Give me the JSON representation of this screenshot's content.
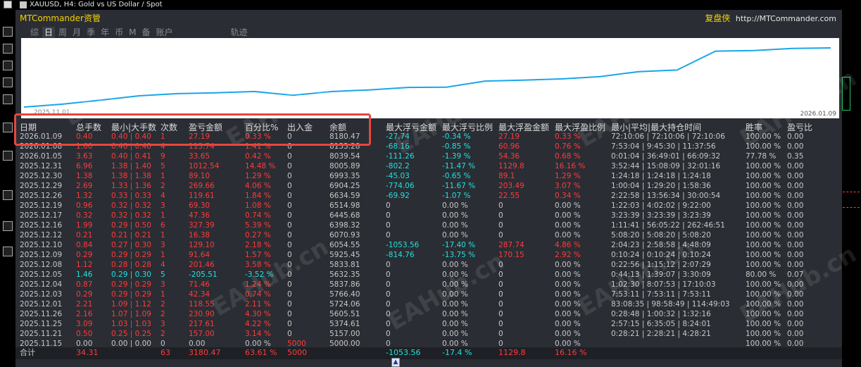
{
  "window": {
    "symbol_line": "XAUUSD, H4:  Gold vs US Dollar / Spot"
  },
  "panel": {
    "brand": "MTCommander资管",
    "right_brand_cn": "复盘侠",
    "right_brand_url": "http://MTCommander.com",
    "tabs": [
      "综",
      "日",
      "周",
      "月",
      "季",
      "年",
      "币",
      "M",
      "备",
      "账户",
      "轨迹"
    ],
    "active_tab": "日",
    "chart_start_label": "2025.11.01",
    "chart_end_label": "2026.01.09"
  },
  "colors": {
    "accent": "#f7d000",
    "profit_red": "#ff3b3b",
    "loss_cyan": "#22e0e0",
    "curve": "#1aa6e8",
    "highlight_box": "#e8463d"
  },
  "equity_curve": [
    5000.0,
    5157.0,
    5374.61,
    5605.51,
    5724.06,
    5766.4,
    5837.86,
    5632.35,
    5833.81,
    5925.45,
    6054.55,
    6070.93,
    6398.32,
    6445.68,
    6514.98,
    6634.59,
    6904.25,
    6993.35,
    8005.89,
    8039.54,
    8153.28,
    8180.47
  ],
  "table": {
    "headers": [
      "日期",
      "总手数",
      "最小|大手数",
      "次数",
      "盈亏金额",
      "百分比%",
      "出入金",
      "余额",
      "最大浮亏金额",
      "最大浮亏比例",
      "最大浮盈金额",
      "最大浮盈比例",
      "最小|平均|最大持仓时间",
      "胜率",
      "盈亏比"
    ],
    "rows": [
      [
        "2026.01.09",
        "0.40",
        "0.40 | 0.40",
        "1",
        "27.19",
        "0.33 %",
        "0",
        "8180.47",
        "-27.74",
        "-0.34 %",
        "27.19",
        "0.33 %",
        "72:10:06 | 72:10:06 | 72:10:06",
        "100.00 %",
        "0.00"
      ],
      [
        "2026.01.08",
        "1.60",
        "0.40 | 0.40",
        "4",
        "113.74",
        "1.41 %",
        "0",
        "8153.28",
        "-68.16",
        "-0.85 %",
        "60.96",
        "0.76 %",
        "7:53:04 | 9:45:30 | 11:37:56",
        "100.00 %",
        "0.00"
      ],
      [
        "2026.01.05",
        "3.63",
        "0.40 | 0.41",
        "9",
        "33.65",
        "0.42 %",
        "0",
        "8039.54",
        "-111.26",
        "-1.39 %",
        "54.36",
        "0.68 %",
        "0:01:04 | 36:49:01 | 66:09:32",
        "77.78 %",
        "0.35"
      ],
      [
        "2025.12.31",
        "6.96",
        "1.38 | 1.40",
        "5",
        "1012.54",
        "14.48 %",
        "0",
        "8005.89",
        "-802.2",
        "-11.47 %",
        "1129.8",
        "16.16 %",
        "3:52:44 | 15:08:09 | 32:01:16",
        "100.00 %",
        "0.00"
      ],
      [
        "2025.12.30",
        "1.38",
        "1.38 | 1.38",
        "1",
        "89.10",
        "1.29 %",
        "0",
        "6993.35",
        "-45.03",
        "-0.65 %",
        "89.1",
        "1.29 %",
        "1:24:18 | 1:24:18 | 1:24:18",
        "100.00 %",
        "0.00"
      ],
      [
        "2025.12.29",
        "2.69",
        "1.33 | 1.36",
        "2",
        "269.66",
        "4.06 %",
        "0",
        "6904.25",
        "-774.06",
        "-11.67 %",
        "203.49",
        "3.07 %",
        "1:00:04 | 1:29:20 | 1:58:36",
        "100.00 %",
        "0.00"
      ],
      [
        "2025.12.26",
        "1.32",
        "0.33 | 0.33",
        "4",
        "119.61",
        "1.84 %",
        "0",
        "6634.59",
        "-69.92",
        "-1.07 %",
        "22.55",
        "0.34 %",
        "2:22:58 | 13:56:34 | 30:00:54",
        "100.00 %",
        "0.00"
      ],
      [
        "2025.12.19",
        "0.96",
        "0.32 | 0.32",
        "3",
        "69.30",
        "1.08 %",
        "0",
        "6514.98",
        "0",
        "0.00 %",
        "0",
        "0.00 %",
        "1:22:03 | 4:02:02 | 9:22:00",
        "100.00 %",
        "0.00"
      ],
      [
        "2025.12.17",
        "0.32",
        "0.32 | 0.32",
        "1",
        "47.36",
        "0.74 %",
        "0",
        "6445.68",
        "0",
        "0.00 %",
        "0",
        "0.00 %",
        "3:23:39 | 3:23:39 | 3:23:39",
        "100.00 %",
        "0.00"
      ],
      [
        "2025.12.16",
        "1.99",
        "0.29 | 0.50",
        "6",
        "327.39",
        "5.39 %",
        "0",
        "6398.32",
        "0",
        "0.00 %",
        "0",
        "0.00 %",
        "1:11:41 | 56:05:22 | 262:46:51",
        "100.00 %",
        "0.00"
      ],
      [
        "2025.12.12",
        "0.21",
        "0.21 | 0.21",
        "1",
        "16.38",
        "0.27 %",
        "0",
        "6070.93",
        "0",
        "0.00 %",
        "0",
        "0.00 %",
        "5:08:20 | 5:08:20 | 5:08:20",
        "100.00 %",
        "0.00"
      ],
      [
        "2025.12.10",
        "0.84",
        "0.27 | 0.30",
        "3",
        "129.10",
        "2.18 %",
        "0",
        "6054.55",
        "-1053.56",
        "-17.40 %",
        "287.74",
        "4.86 %",
        "2:04:23 | 2:58:58 | 4:48:09",
        "100.00 %",
        "0.00"
      ],
      [
        "2025.12.09",
        "0.29",
        "0.29 | 0.29",
        "1",
        "91.64",
        "1.57 %",
        "0",
        "5925.45",
        "-814.76",
        "-13.75 %",
        "170.15",
        "2.92 %",
        "0:10:24 | 0:10:24 | 0:10:24",
        "100.00 %",
        "0.00"
      ],
      [
        "2025.12.08",
        "1.12",
        "0.28 | 0.28",
        "4",
        "201.46",
        "3.58 %",
        "0",
        "5833.81",
        "0",
        "0.00 %",
        "0",
        "0.00 %",
        "0:22:56 | 1:15:12 | 2:07:29",
        "100.00 %",
        "0.00"
      ],
      [
        "2025.12.05",
        "1.46",
        "0.29 | 0.30",
        "5",
        "-205.51",
        "-3.52 %",
        "0",
        "5632.35",
        "0",
        "0.00 %",
        "0",
        "0.00 %",
        "0:44:13 | 1:39:07 | 3:30:09",
        "80.00 %",
        "0.07"
      ],
      [
        "2025.12.04",
        "0.87",
        "0.29 | 0.29",
        "3",
        "71.46",
        "1.24 %",
        "0",
        "5837.86",
        "0",
        "0.00 %",
        "0",
        "0.00 %",
        "1:02:30 | 8:07:53 | 17:10:03",
        "100.00 %",
        "0.00"
      ],
      [
        "2025.12.03",
        "0.29",
        "0.29 | 0.29",
        "1",
        "42.34",
        "0.74 %",
        "0",
        "5766.40",
        "0",
        "0.00 %",
        "0",
        "0.00 %",
        "7:53:11 | 7:53:11 | 7:53:11",
        "100.00 %",
        "0.00"
      ],
      [
        "2025.12.01",
        "2.21",
        "1.09 | 1.12",
        "2",
        "118.55",
        "2.11 %",
        "0",
        "5724.06",
        "0",
        "0.00 %",
        "0",
        "0.00 %",
        "83:08:35 | 98:58:49 | 114:49:03",
        "100.00 %",
        "0.00"
      ],
      [
        "2025.11.26",
        "2.16",
        "1.07 | 1.09",
        "2",
        "230.90",
        "4.30 %",
        "0",
        "5605.51",
        "0",
        "0.00 %",
        "0",
        "0.00 %",
        "0:28:48 | 1:00:32 | 1:32:16",
        "100.00 %",
        "0.00"
      ],
      [
        "2025.11.25",
        "3.09",
        "1.03 | 1.03",
        "3",
        "217.61",
        "4.22 %",
        "0",
        "5374.61",
        "0",
        "0.00 %",
        "0",
        "0.00 %",
        "2:57:15 | 6:35:05 | 8:24:01",
        "100.00 %",
        "0.00"
      ],
      [
        "2025.11.21",
        "0.50",
        "0.25 | 0.25",
        "2",
        "157.00",
        "3.14 %",
        "0",
        "5157.00",
        "0",
        "0.00 %",
        "0",
        "0.00 %",
        "0:28:21 | 2:28:21 | 4:28:21",
        "100.00 %",
        "0.00"
      ],
      [
        "2025.11.15",
        "0.00",
        "0.00 | 0.00",
        "0",
        "0.00",
        "0.00 %",
        "5000",
        "5000.00",
        "0",
        "0.00 %",
        "0",
        "0.00 %",
        "",
        "100.00 %",
        "0.00"
      ]
    ],
    "totals": [
      "合计",
      "34.31",
      "",
      "63",
      "3180.47",
      "63.61 %",
      "5000",
      "",
      "-1053.56",
      "-17.4 %",
      "1129.8",
      "16.16 %",
      "",
      "",
      ""
    ]
  },
  "watermark": "EAHub.cn"
}
